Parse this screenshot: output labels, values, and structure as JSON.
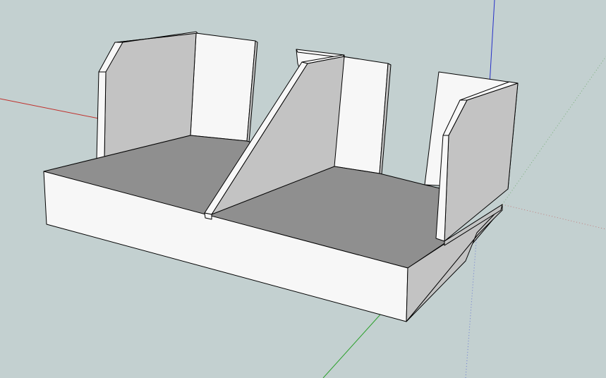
{
  "app": {
    "view": "3d-model-viewport"
  },
  "colors": {
    "background": "#c3d0d0",
    "axis_red": "#c0302c",
    "axis_green": "#2aa02a",
    "axis_blue": "#2630c8",
    "face_light": "#f7f7f7",
    "face_mid": "#c3c3c3",
    "face_dark": "#8f8f8f",
    "edge": "#000000"
  },
  "model": {
    "name": "wood-part-model",
    "parts": [
      "base-board",
      "left-side-panel",
      "back-left-panel",
      "center-divider",
      "back-center-panel",
      "right-side-panel",
      "back-right-panel"
    ]
  }
}
